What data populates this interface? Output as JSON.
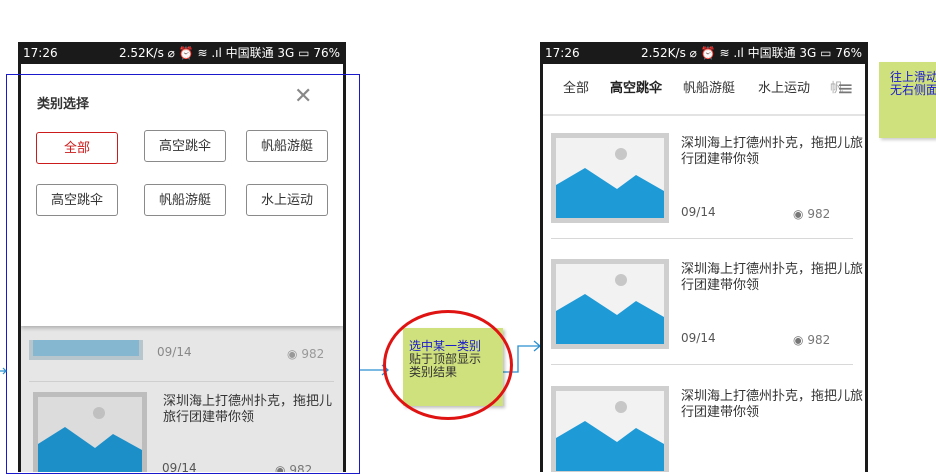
{
  "status_bar": {
    "time": "17:26",
    "right": "2.52K/s ⌀ ⏰ ≋ .ıl 中国联通 3G ▭ 76%"
  },
  "left_phone": {
    "dialog": {
      "title": "类别选择",
      "close": "✕",
      "categories": [
        "全部",
        "高空跳伞",
        "帆船游艇",
        "高空跳伞",
        "帆船游艇",
        "水上运动"
      ]
    },
    "background_list": {
      "partial_date": "09/14",
      "partial_views": "982",
      "item": {
        "title": "深圳海上打德州扑克，拖把儿旅行团建带你领",
        "date": "09/14",
        "views": "982"
      }
    }
  },
  "annotation_middle": {
    "text_line1": "选中某一类别",
    "text_line2": "贴于顶部显示",
    "text_line3": "类别结果"
  },
  "right_phone": {
    "tabs": [
      "全部",
      "高空跳伞",
      "帆船游艇",
      "水上运动",
      "帆"
    ],
    "menu_icon": "≡",
    "items": [
      {
        "title": "深圳海上打德州扑克，拖把儿旅行团建带你领",
        "date": "09/14",
        "views": "982"
      },
      {
        "title": "深圳海上打德州扑克，拖把儿旅行团建带你领",
        "date": "09/14",
        "views": "982"
      },
      {
        "title": "深圳海上打德州扑克，拖把儿旅行团建带你领"
      }
    ]
  },
  "annotation_right": {
    "text_line1": "往上滑动",
    "text_line2": "无右侧面"
  },
  "colors": {
    "accent_red": "#cc1b1b",
    "image_blue": "#1e9ad6",
    "note_green": "#cfe17d",
    "connector_blue": "#2a8fd1",
    "highlight_blue": "#1a1acc"
  }
}
